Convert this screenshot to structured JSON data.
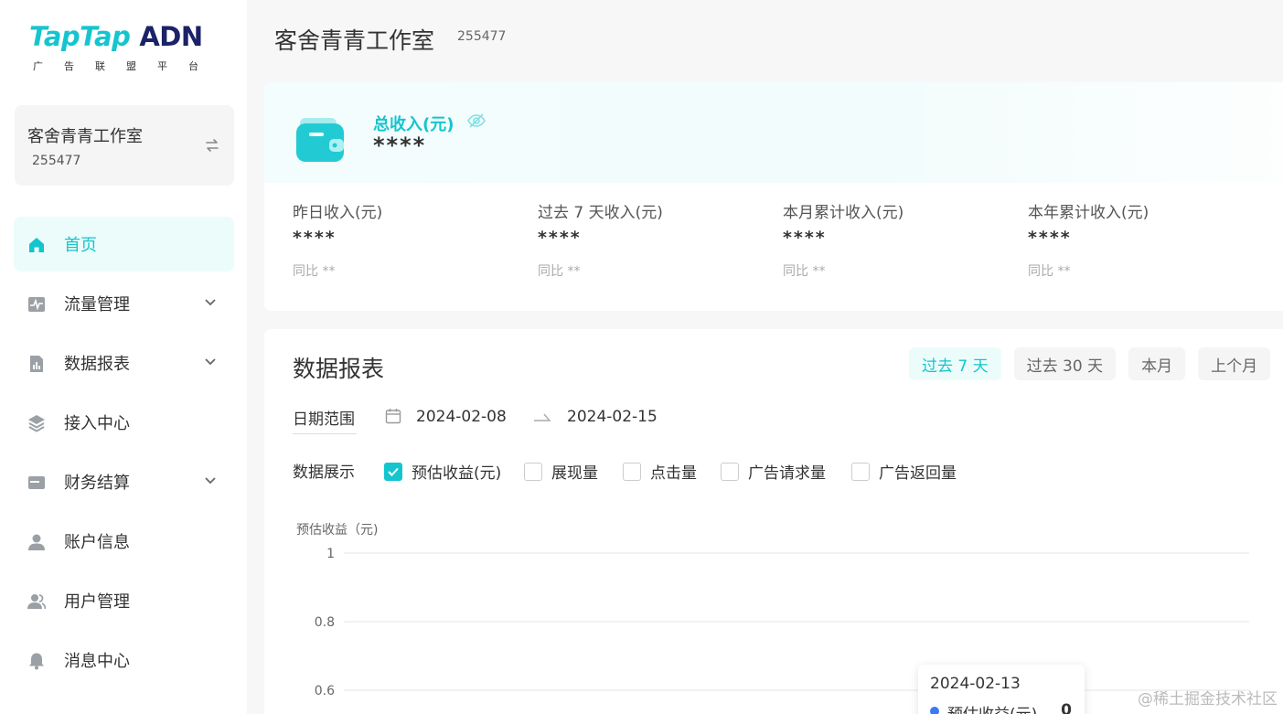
{
  "logo": {
    "tap": "TapTap",
    "adn": "ADN",
    "subtitle": "广告联盟平台"
  },
  "account": {
    "name": "客舍青青工作室",
    "id": "255477"
  },
  "sidebar": {
    "items": [
      {
        "label": "首页",
        "icon": "home-icon",
        "active": true,
        "expandable": false
      },
      {
        "label": "流量管理",
        "icon": "pulse-icon",
        "active": false,
        "expandable": true
      },
      {
        "label": "数据报表",
        "icon": "report-icon",
        "active": false,
        "expandable": true
      },
      {
        "label": "接入中心",
        "icon": "layers-icon",
        "active": false,
        "expandable": false
      },
      {
        "label": "财务结算",
        "icon": "card-icon",
        "active": false,
        "expandable": true
      },
      {
        "label": "账户信息",
        "icon": "user-icon",
        "active": false,
        "expandable": false
      },
      {
        "label": "用户管理",
        "icon": "users-icon",
        "active": false,
        "expandable": false
      },
      {
        "label": "消息中心",
        "icon": "bell-icon",
        "active": false,
        "expandable": false
      }
    ]
  },
  "header": {
    "title": "客舍青青工作室",
    "id": "255477"
  },
  "income": {
    "total_label": "总收入(元)",
    "total_value": "****",
    "stats": [
      {
        "label": "昨日收入(元)",
        "value": "****",
        "compare": "同比 **"
      },
      {
        "label": "过去 7 天收入(元)",
        "value": "****",
        "compare": "同比 **"
      },
      {
        "label": "本月累计收入(元)",
        "value": "****",
        "compare": "同比 **"
      },
      {
        "label": "本年累计收入(元)",
        "value": "****",
        "compare": "同比 **"
      }
    ]
  },
  "report": {
    "title": "数据报表",
    "range_tabs": [
      {
        "label": "过去 7 天",
        "active": true
      },
      {
        "label": "过去 30 天",
        "active": false
      },
      {
        "label": "本月",
        "active": false
      },
      {
        "label": "上个月",
        "active": false
      }
    ],
    "date_label": "日期范围",
    "date_start": "2024-02-08",
    "date_end": "2024-02-15",
    "display_label": "数据展示",
    "metrics": [
      {
        "label": "预估收益(元)",
        "checked": true
      },
      {
        "label": "展现量",
        "checked": false
      },
      {
        "label": "点击量",
        "checked": false
      },
      {
        "label": "广告请求量",
        "checked": false
      },
      {
        "label": "广告返回量",
        "checked": false
      }
    ]
  },
  "chart_data": {
    "type": "line",
    "ylabel": "预估收益（元)",
    "yticks": [
      "1",
      "0.8",
      "0.6"
    ],
    "ylim": [
      0.6,
      1
    ],
    "grid": true,
    "series": [
      {
        "name": "预估收益(元)",
        "x": [
          "2024-02-13"
        ],
        "values": [
          0
        ]
      }
    ]
  },
  "tooltip": {
    "date": "2024-02-13",
    "series_name": "预估收益(元)",
    "value": "0"
  },
  "watermark": "@稀土掘金技术社区",
  "colors": {
    "accent": "#15c5ce",
    "brand_dark": "#1a2268",
    "active_bg": "#ebfcfb",
    "series": "#3b7bf2"
  }
}
